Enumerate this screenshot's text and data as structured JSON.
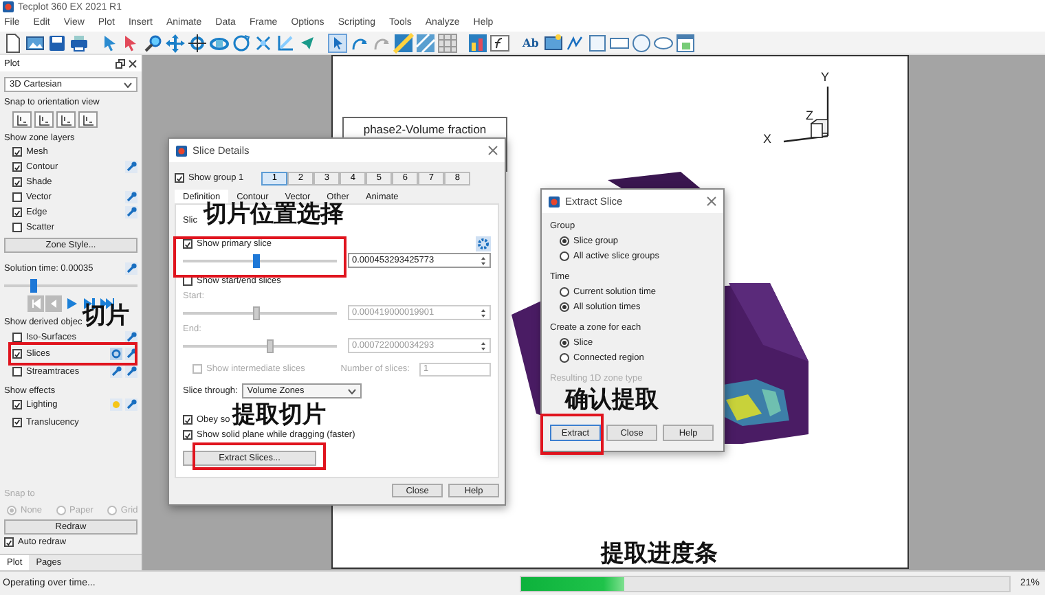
{
  "window": {
    "title": "Tecplot 360 EX 2021 R1"
  },
  "menu": [
    "File",
    "Edit",
    "View",
    "Plot",
    "Insert",
    "Animate",
    "Data",
    "Frame",
    "Options",
    "Scripting",
    "Tools",
    "Analyze",
    "Help"
  ],
  "toolbar": {
    "text_tool": "Ab"
  },
  "sidebar": {
    "title": "Plot",
    "plot_type": "3D Cartesian",
    "snap_label": "Snap to orientation view",
    "zone_layers_label": "Show zone layers",
    "zone_layers": [
      {
        "label": "Mesh",
        "checked": true
      },
      {
        "label": "Contour",
        "checked": true
      },
      {
        "label": "Shade",
        "checked": true
      },
      {
        "label": "Vector",
        "checked": false
      },
      {
        "label": "Edge",
        "checked": true
      },
      {
        "label": "Scatter",
        "checked": false
      }
    ],
    "zone_style_button": "Zone Style...",
    "solution_time": "Solution time: 0.00035",
    "time_slider": {
      "level": 0.22
    },
    "derived_label": "Show derived objec",
    "derived": [
      {
        "label": "Iso-Surfaces",
        "checked": false
      },
      {
        "label": "Slices",
        "checked": true
      },
      {
        "label": "Streamtraces",
        "checked": false
      }
    ],
    "effects_label": "Show effects",
    "effects": [
      {
        "label": "Lighting",
        "checked": true
      },
      {
        "label": "Translucency",
        "checked": true
      }
    ],
    "snap_to": {
      "label": "Snap to",
      "disabled": true,
      "options": [
        {
          "label": "None",
          "selected": true
        },
        {
          "label": "Paper",
          "selected": false
        },
        {
          "label": "Grid",
          "selected": false
        }
      ]
    },
    "redraw_button": "Redraw",
    "auto_redraw": {
      "label": "Auto redraw",
      "checked": true
    },
    "tabs": [
      {
        "label": "Plot",
        "selected": true
      },
      {
        "label": "Pages",
        "selected": false
      }
    ]
  },
  "plot": {
    "legend_title": "phase2-Volume fraction",
    "axes": {
      "x": "X",
      "y": "Y",
      "z": "Z"
    }
  },
  "slice_details": {
    "title": "Slice Details",
    "show_group": {
      "label": "Show group 1",
      "checked": true
    },
    "groups": [
      {
        "label": "1",
        "selected": true
      },
      {
        "label": "2",
        "selected": false
      },
      {
        "label": "3",
        "selected": false
      },
      {
        "label": "4",
        "selected": false
      },
      {
        "label": "5",
        "selected": false
      },
      {
        "label": "6",
        "selected": false
      },
      {
        "label": "7",
        "selected": false
      },
      {
        "label": "8",
        "selected": false
      }
    ],
    "tabs": [
      {
        "label": "Definition",
        "selected": true
      },
      {
        "label": "Contour",
        "selected": false
      },
      {
        "label": "Vector",
        "selected": false
      },
      {
        "label": "Other",
        "selected": false
      },
      {
        "label": "Animate",
        "selected": false
      }
    ],
    "slice_label": "Slic",
    "primary": {
      "label": "Show primary slice",
      "checked": true,
      "level": 0.47,
      "value": "0.000453293425773"
    },
    "start_end": {
      "label": "Show start/end slices",
      "checked": false
    },
    "start": {
      "label": "Start:",
      "disabled": true,
      "level": 0.47,
      "value": "0.000419000019901"
    },
    "end": {
      "label": "End:",
      "disabled": true,
      "level": 0.56,
      "value": "0.000722000034293"
    },
    "intermediate": {
      "label": "Show intermediate slices",
      "checked": false,
      "disabled": true
    },
    "number_label": "Number of slices:",
    "number_value": "1",
    "slice_through_label": "Slice through:",
    "slice_through": "Volume Zones",
    "options": [
      {
        "label": "Obey so",
        "checked": true
      },
      {
        "label": "Show solid plane while dragging (faster)",
        "checked": true
      }
    ],
    "extract_button": "Extract Slices...",
    "buttons": [
      "Close",
      "Help"
    ]
  },
  "extract_slice": {
    "title": "Extract Slice",
    "sections": [
      {
        "label": "Group",
        "options": [
          {
            "label": "Slice group",
            "selected": true
          },
          {
            "label": "All active slice groups",
            "selected": false
          }
        ]
      },
      {
        "label": "Time",
        "options": [
          {
            "label": "Current solution time",
            "selected": false
          },
          {
            "label": "All solution times",
            "selected": true
          }
        ]
      },
      {
        "label": "Create a zone for each",
        "options": [
          {
            "label": "Slice",
            "selected": true
          },
          {
            "label": "Connected region",
            "selected": false
          }
        ]
      }
    ],
    "zone_type_label": "Resulting 1D zone type",
    "buttons": [
      "Extract",
      "Close",
      "Help"
    ]
  },
  "annotations": [
    "切片位置选择",
    "切片",
    "提取切片",
    "确认提取",
    "提取进度条"
  ],
  "status_bar": {
    "text": "Operating over time...",
    "progress": {
      "level": 0.21
    },
    "percent": "21%"
  }
}
